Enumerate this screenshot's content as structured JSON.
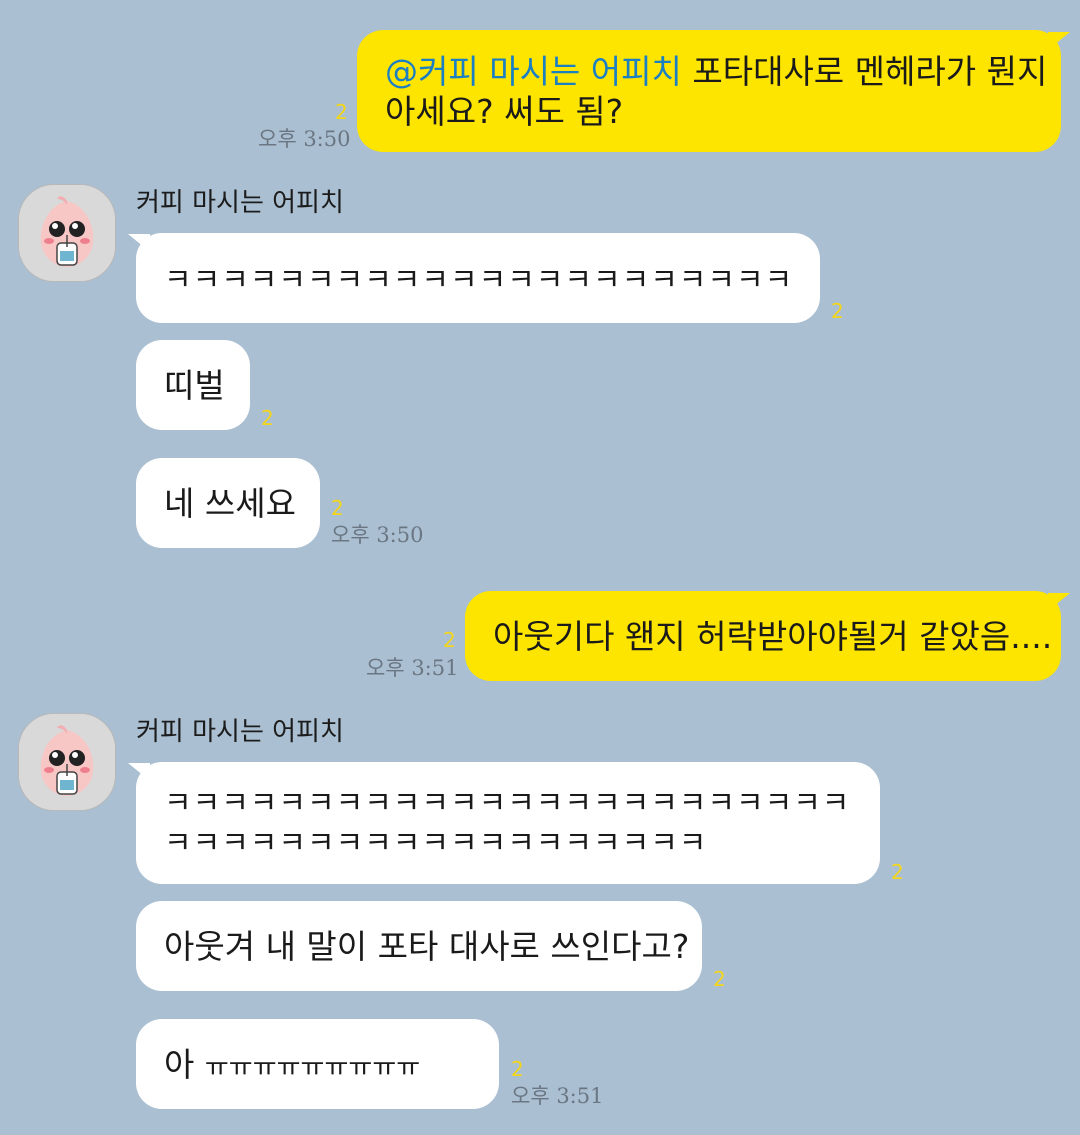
{
  "colors": {
    "background": "#aabfd1",
    "my_bubble": "#fee500",
    "their_bubble": "#ffffff",
    "mention": "#1b7fc4",
    "unread": "#f3d61a"
  },
  "messages": [
    {
      "mention": "@커피 마시는 어피치",
      "line1_rest": " 포타대사로 멘헤라가 뭔지",
      "line2": "아세요? 써도 됨?",
      "unread": "2",
      "time": "오후 3:50"
    },
    {
      "sender": "커피 마시는 어피치",
      "text": "ㅋㅋㅋㅋㅋㅋㅋㅋㅋㅋㅋㅋㅋㅋㅋㅋㅋㅋㅋㅋㅋㅋ",
      "unread": "2"
    },
    {
      "text": "띠벌",
      "unread": "2"
    },
    {
      "text": "네 쓰세요",
      "unread": "2",
      "time": "오후 3:50"
    },
    {
      "text": "아웃기다 왠지 허락받아야될거 같았음....",
      "unread": "2",
      "time": "오후 3:51"
    },
    {
      "sender": "커피 마시는 어피치",
      "line1": "ㅋㅋㅋㅋㅋㅋㅋㅋㅋㅋㅋㅋㅋㅋㅋㅋㅋㅋㅋㅋㅋㅋㅋㅋ",
      "line2": "ㅋㅋㅋㅋㅋㅋㅋㅋㅋㅋㅋㅋㅋㅋㅋㅋㅋㅋㅋ",
      "unread": "2"
    },
    {
      "text": "아웃겨 내 말이 포타 대사로 쓰인다고?",
      "unread": "2"
    },
    {
      "prefix": "아",
      "crying": "ㅠㅠㅠㅠㅠㅠㅠㅠㅠ",
      "unread": "2",
      "time": "오후 3:51"
    }
  ],
  "avatar": {
    "icon": "apeach-avatar-icon"
  }
}
